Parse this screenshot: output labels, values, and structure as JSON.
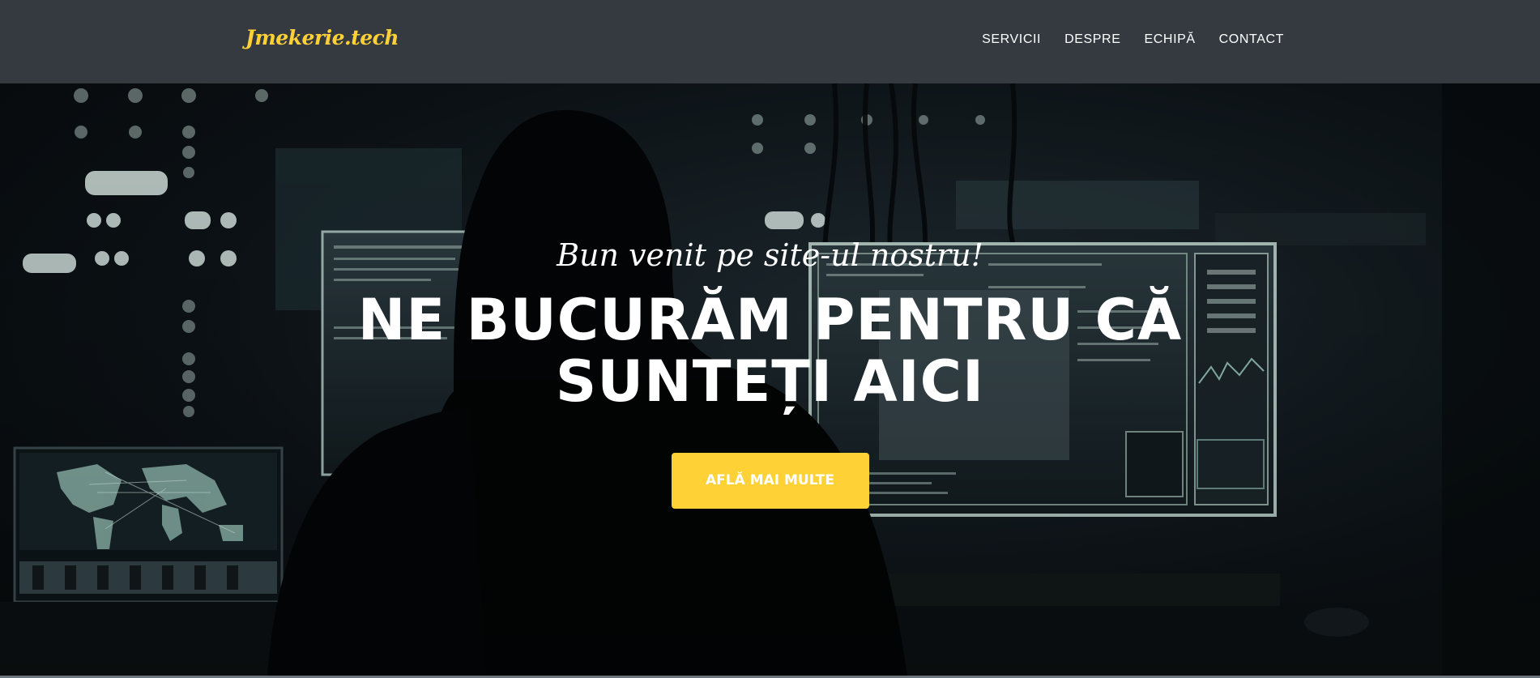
{
  "navbar": {
    "brand": "Jmekerie.tech",
    "links": [
      "SERVICII",
      "DESPRE",
      "ECHIPĂ",
      "CONTACT"
    ]
  },
  "hero": {
    "subheading": "Bun venit pe site-ul nostru!",
    "heading": "NE BUCURĂM PENTRU CĂ SUNTEȚI AICI",
    "button_label": "AFLĂ MAI MULTE",
    "background_image": "hooded-hacker-at-monitors"
  },
  "colors": {
    "navbar_bg": "#343a40",
    "accent": "#fed136",
    "text": "#ffffff"
  }
}
